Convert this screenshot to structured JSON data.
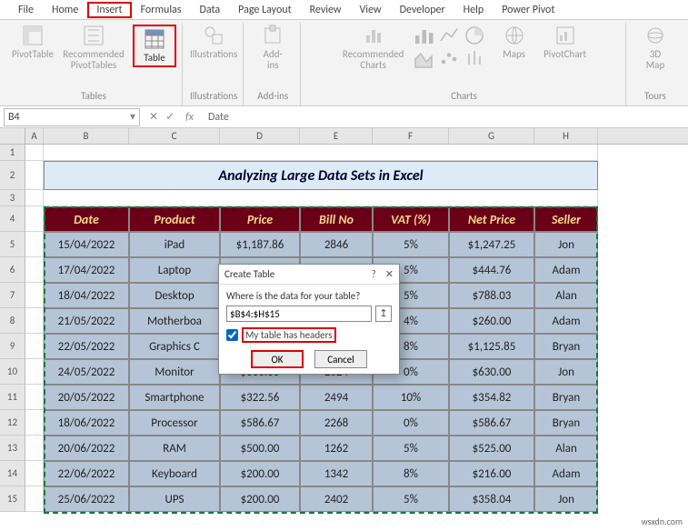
{
  "menus": [
    "File",
    "Home",
    "Insert",
    "Formulas",
    "Data",
    "Page Layout",
    "Review",
    "View",
    "Developer",
    "Help",
    "Power Pivot"
  ],
  "activeMenuIndex": 2,
  "ribbon": {
    "groups": [
      {
        "label": "Tables",
        "buttons": [
          {
            "name": "pivottable",
            "label": "PivotTable"
          },
          {
            "name": "recommended-pivot",
            "label": "Recommended\nPivotTables"
          },
          {
            "name": "table",
            "label": "Table",
            "active": true
          }
        ]
      },
      {
        "label": "Illustrations",
        "buttons": [
          {
            "name": "illustrations",
            "label": "Illustrations"
          }
        ]
      },
      {
        "label": "Add-ins",
        "buttons": [
          {
            "name": "addins",
            "label": "Add-\nins"
          }
        ]
      },
      {
        "label": "Charts",
        "buttons": [
          {
            "name": "recommended-charts",
            "label": "Recommended\nCharts"
          },
          {
            "name": "chart-gallery",
            "label": ""
          },
          {
            "name": "maps",
            "label": "Maps"
          },
          {
            "name": "pivotchart",
            "label": "PivotChart"
          }
        ]
      },
      {
        "label": "Tours",
        "buttons": [
          {
            "name": "3dmap",
            "label": "3D\nMap"
          }
        ]
      }
    ]
  },
  "namebox": "B4",
  "formula": "Date",
  "columns": [
    "A",
    "B",
    "C",
    "D",
    "E",
    "F",
    "G",
    "H"
  ],
  "title": "Analyzing Large Data Sets in Excel",
  "headers": [
    "Date",
    "Product",
    "Price",
    "Bill No",
    "VAT (%)",
    "Net Price",
    "Seller"
  ],
  "rows": [
    {
      "n": 5,
      "c": [
        "15/04/2022",
        "iPad",
        "$1,187.86",
        "2846",
        "5%",
        "$1,247.25",
        "Jon"
      ]
    },
    {
      "n": 6,
      "c": [
        "17/04/2022",
        "Laptop",
        "",
        "",
        "5%",
        "$444.76",
        "Adam"
      ]
    },
    {
      "n": 7,
      "c": [
        "18/04/2022",
        "Desktop",
        "",
        "",
        "5%",
        "$788.03",
        "Alan"
      ]
    },
    {
      "n": 8,
      "c": [
        "21/05/2022",
        "Motherboa",
        "",
        "",
        "4%",
        "$260.00",
        "Adam"
      ]
    },
    {
      "n": 9,
      "c": [
        "22/05/2022",
        "Graphics C",
        "",
        "",
        "8%",
        "$1,125.85",
        "Bryan"
      ]
    },
    {
      "n": 10,
      "c": [
        "24/05/2022",
        "Monitor",
        "$030.00",
        "2024",
        "0%",
        "$630.00",
        "Jon"
      ]
    },
    {
      "n": 11,
      "c": [
        "20/05/2022",
        "Smartphone",
        "$322.56",
        "2494",
        "10%",
        "$354.82",
        "Bryan"
      ]
    },
    {
      "n": 12,
      "c": [
        "18/06/2022",
        "Processor",
        "$586.67",
        "2268",
        "0%",
        "$586.67",
        "Bryan"
      ]
    },
    {
      "n": 13,
      "c": [
        "20/06/2022",
        "RAM",
        "$500.00",
        "1262",
        "5%",
        "$525.00",
        "Alan"
      ]
    },
    {
      "n": 14,
      "c": [
        "22/06/2022",
        "Keyboard",
        "$200.00",
        "1342",
        "8%",
        "$216.00",
        "Adam"
      ]
    },
    {
      "n": 15,
      "c": [
        "25/06/2022",
        "UPS",
        "$200.00",
        "2402",
        "5%",
        "$358.04",
        "Jon"
      ]
    }
  ],
  "dialog": {
    "title": "Create Table",
    "prompt": "Where is the data for your table?",
    "range": "$B$4:$H$15",
    "checkbox": "My table has headers",
    "ok": "OK",
    "cancel": "Cancel",
    "help": "?",
    "close": "✕"
  },
  "watermark": "wsxdn.com"
}
